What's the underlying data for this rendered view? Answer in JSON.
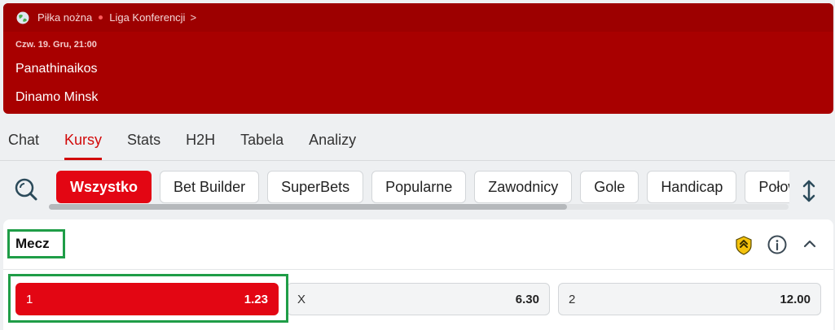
{
  "breadcrumb": {
    "sport": "Piłka nożna",
    "league": "Liga Konferencji",
    "chevron": ">"
  },
  "match": {
    "datetime": "Czw. 19. Gru, 21:00",
    "home": "Panathinaikos",
    "away": "Dinamo Minsk"
  },
  "tabs": [
    {
      "label": "Chat",
      "active": false
    },
    {
      "label": "Kursy",
      "active": true
    },
    {
      "label": "Stats",
      "active": false
    },
    {
      "label": "H2H",
      "active": false
    },
    {
      "label": "Tabela",
      "active": false
    },
    {
      "label": "Analizy",
      "active": false
    }
  ],
  "filters": [
    "Wszystko",
    "Bet Builder",
    "SuperBets",
    "Popularne",
    "Zawodnicy",
    "Gole",
    "Handicap",
    "Połowy"
  ],
  "filter_scroll_fraction": 0.7,
  "market": {
    "title": "Mecz",
    "outcomes": [
      {
        "label": "1",
        "odds": "1.23",
        "selected": true
      },
      {
        "label": "X",
        "odds": "6.30",
        "selected": false
      },
      {
        "label": "2",
        "odds": "12.00",
        "selected": false
      }
    ]
  },
  "colors": {
    "header_bg": "#a80000",
    "accent": "#e30613",
    "highlight": "#1f9d47"
  },
  "icons": [
    "globe-icon",
    "search-icon",
    "sort-icon",
    "bet-builder-icon",
    "info-icon",
    "chevron-up-icon"
  ]
}
